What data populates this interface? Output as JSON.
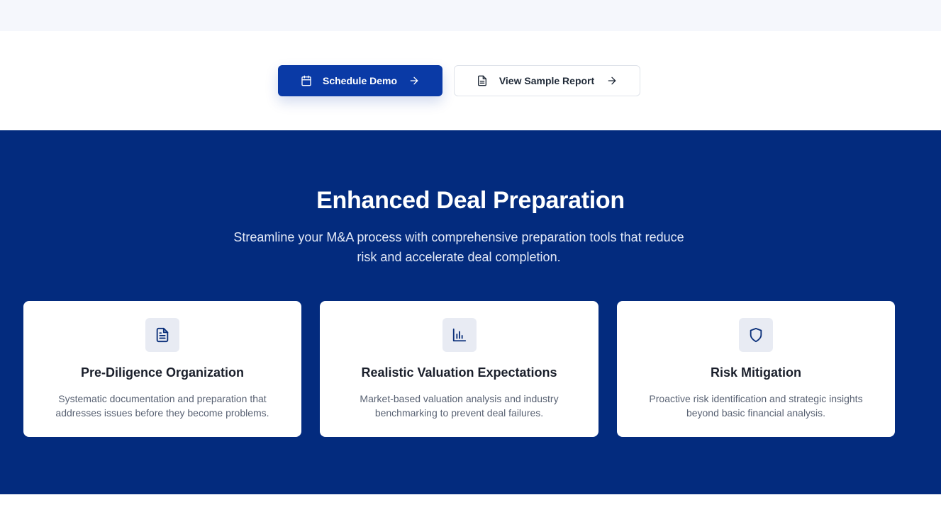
{
  "cta": {
    "primary": {
      "label": "Schedule Demo",
      "icon": "calendar-icon",
      "trail_icon": "arrow-right-icon"
    },
    "secondary": {
      "label": "View Sample Report",
      "icon": "document-icon",
      "trail_icon": "arrow-right-icon"
    }
  },
  "section": {
    "title": "Enhanced Deal Preparation",
    "subtitle": "Streamline your M&A process with comprehensive preparation tools that reduce risk and accelerate deal completion."
  },
  "cards": [
    {
      "icon": "document-text-icon",
      "title": "Pre-Diligence Organization",
      "description": "Systematic documentation and preparation that addresses issues before they become problems."
    },
    {
      "icon": "bar-chart-icon",
      "title": "Realistic Valuation Expectations",
      "description": "Market-based valuation analysis and industry benchmarking to prevent deal failures."
    },
    {
      "icon": "shield-icon",
      "title": "Risk Mitigation",
      "description": "Proactive risk identification and strategic insights beyond basic financial analysis."
    }
  ],
  "colors": {
    "primary": "#0a3aa6",
    "section_bg": "#032b7e",
    "icon_color": "#0a2f7a"
  }
}
